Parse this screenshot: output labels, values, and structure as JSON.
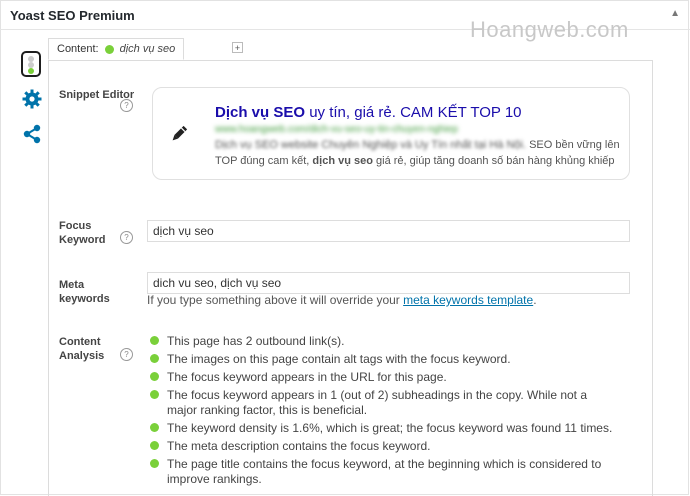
{
  "metabox": {
    "title": "Yoast SEO Premium",
    "collapse_icon": "triangle-up"
  },
  "watermark": "Hoangweb.com",
  "tab": {
    "label": "Content:",
    "keyword": "dịch vụ seo",
    "status_color": "#7ad03a",
    "add_label": "+"
  },
  "snippet": {
    "label": "Snippet Editor",
    "help": "?",
    "title_bold": "Dịch vụ SEO",
    "title_rest": " uy tín, giá rẻ. CAM KẾT TOP 10",
    "url": "www.hoangweb.com/dich-vu-seo-uy-tin-chuyen-nghiep",
    "desc_prefix": "Dịch vụ SEO website Chuyên Nghiệp và Uy Tín nhất tại Hà Nội.",
    "desc_part1": " SEO bền vững lên TOP đúng cam kết, ",
    "desc_bold": "dịch vụ seo",
    "desc_part2": " giá rẻ, giúp tăng doanh số bán hàng khủng khiếp"
  },
  "focus": {
    "label_line1": "Focus",
    "label_line2": "Keyword",
    "help": "?",
    "value": "dịch vụ seo"
  },
  "meta": {
    "label_line1": "Meta",
    "label_line2": "keywords",
    "value": "dich vu seo, dịch vụ seo",
    "hint": "If you type something above it will override your ",
    "hint_link": "meta keywords template",
    "hint_end": "."
  },
  "analysis": {
    "label_line1": "Content",
    "label_line2": "Analysis",
    "help": "?",
    "items": [
      "This page has 2 outbound link(s).",
      "The images on this page contain alt tags with the focus keyword.",
      "The focus keyword appears in the URL for this page.",
      "The focus keyword appears in 1 (out of 2) subheadings in the copy. While not a major ranking factor, this is beneficial.",
      "The keyword density is 1.6%, which is great; the focus keyword was found 11 times.",
      "The meta description contains the focus keyword.",
      "The page title contains the focus keyword, at the beginning which is considered to improve rankings."
    ]
  }
}
